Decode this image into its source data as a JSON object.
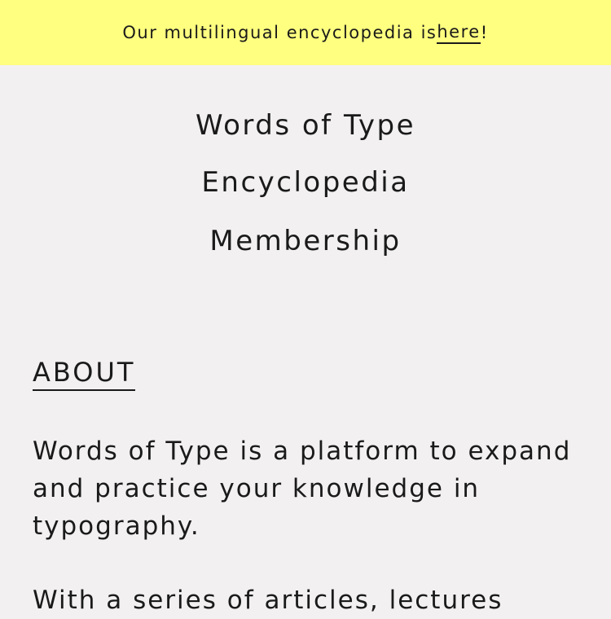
{
  "banner": {
    "text_before": "Our multilingual encyclopedia is ",
    "link_label": "here",
    "text_after": "!",
    "background": "#ffff80"
  },
  "nav": {
    "items": [
      {
        "label": "Words of Type"
      },
      {
        "label": "Encyclopedia"
      },
      {
        "label": "Membership"
      }
    ]
  },
  "about": {
    "heading": "ABOUT",
    "paragraph_1": "Words of Type is a platform to expand and practice your knowledge in typography.",
    "paragraph_2": "With a series of articles, lectures"
  },
  "colors": {
    "page_background": "#f2f0f1",
    "text": "#1a1a1a"
  }
}
